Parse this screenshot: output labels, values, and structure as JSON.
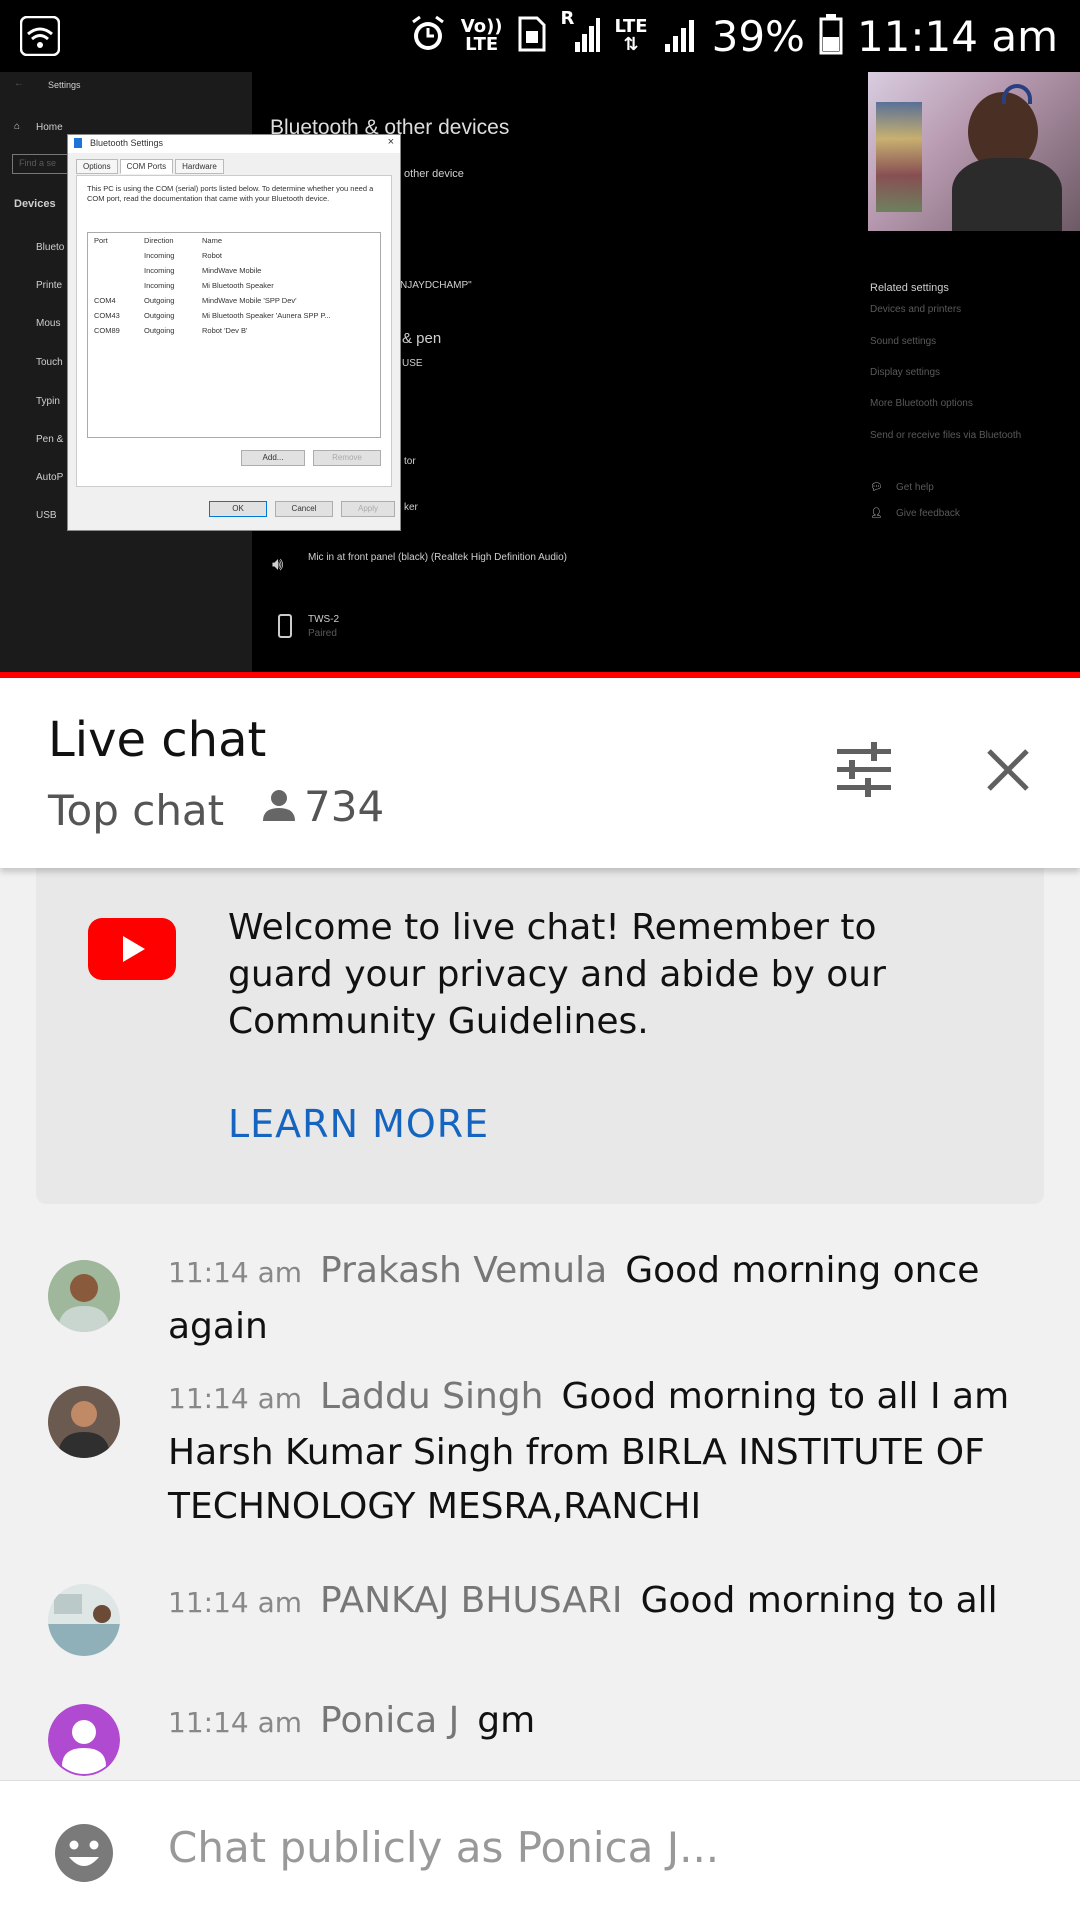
{
  "status_bar": {
    "volte_top": "Vo))",
    "volte_bottom": "LTE",
    "sim_label": "R",
    "lte_label": "LTE",
    "battery": "39%",
    "time": "11:14 am"
  },
  "video": {
    "progress_fraction": 1.0,
    "settings_window": {
      "sidebar_title": "Settings",
      "home": "Home",
      "search_placeholder": "Find a se",
      "section": "Devices",
      "nav_items": [
        "Blueto",
        "Printe",
        "Mous",
        "Touch",
        "Typin",
        "Pen &",
        "AutoP",
        "USB"
      ],
      "page_title": "Bluetooth & other devices",
      "add_device": "other device",
      "device_name_fragment": "NJAYDCHAMP\"",
      "pen_fragment": "& pen",
      "use_fragment": "USE",
      "tor_fragment": "tor",
      "ker_fragment": "ker",
      "mic_device": "Mic in at front panel (black) (Realtek High Definition Audio)",
      "tws_device": "TWS-2",
      "tws_status": "Paired",
      "related_settings": "Related settings",
      "related_links": [
        "Devices and printers",
        "Sound settings",
        "Display settings",
        "More Bluetooth options",
        "Send or receive files via Bluetooth"
      ],
      "get_help": "Get help",
      "give_feedback": "Give feedback"
    },
    "dialog": {
      "title": "Bluetooth Settings",
      "tabs": [
        "Options",
        "COM Ports",
        "Hardware"
      ],
      "description": "This PC is using the COM (serial) ports listed below. To determine whether you need a COM port, read the documentation that came with your Bluetooth device.",
      "columns": [
        "Port",
        "Direction",
        "Name"
      ],
      "rows": [
        {
          "port": "",
          "direction": "Incoming",
          "name": "Robot"
        },
        {
          "port": "",
          "direction": "Incoming",
          "name": "MindWave Mobile"
        },
        {
          "port": "",
          "direction": "Incoming",
          "name": "Mi Bluetooth Speaker"
        },
        {
          "port": "COM4",
          "direction": "Outgoing",
          "name": "MindWave Mobile 'SPP Dev'"
        },
        {
          "port": "COM43",
          "direction": "Outgoing",
          "name": "Mi Bluetooth Speaker 'Aunera SPP P..."
        },
        {
          "port": "COM89",
          "direction": "Outgoing",
          "name": "Robot 'Dev B'"
        }
      ],
      "add_btn": "Add...",
      "remove_btn": "Remove",
      "ok_btn": "OK",
      "cancel_btn": "Cancel",
      "apply_btn": "Apply"
    }
  },
  "chat_header": {
    "title": "Live chat",
    "mode": "Top chat",
    "viewer_count": "734"
  },
  "welcome": {
    "text": "Welcome to live chat! Remember to guard your privacy and abide by our Community Guidelines.",
    "link": "LEARN MORE"
  },
  "messages": [
    {
      "time": "11:14 am",
      "author": "Prakash Vemula",
      "text": "Good morning once again"
    },
    {
      "time": "11:14 am",
      "author": "Laddu Singh",
      "text": "Good morning to all I am Harsh Kumar Singh from BIRLA INSTITUTE OF TECHNOLOGY MESRA,RANCHI"
    },
    {
      "time": "11:14 am",
      "author": "PANKAJ BHUSARI",
      "text": "Good morning to all"
    },
    {
      "time": "11:14 am",
      "author": "Ponica J",
      "text": "gm"
    }
  ],
  "input": {
    "placeholder": "Chat publicly as Ponica J..."
  },
  "colors": {
    "progress": "#ff0000",
    "link": "#1565c0",
    "youtube_red": "#ff0000",
    "default_avatar": "#b04ad0"
  }
}
